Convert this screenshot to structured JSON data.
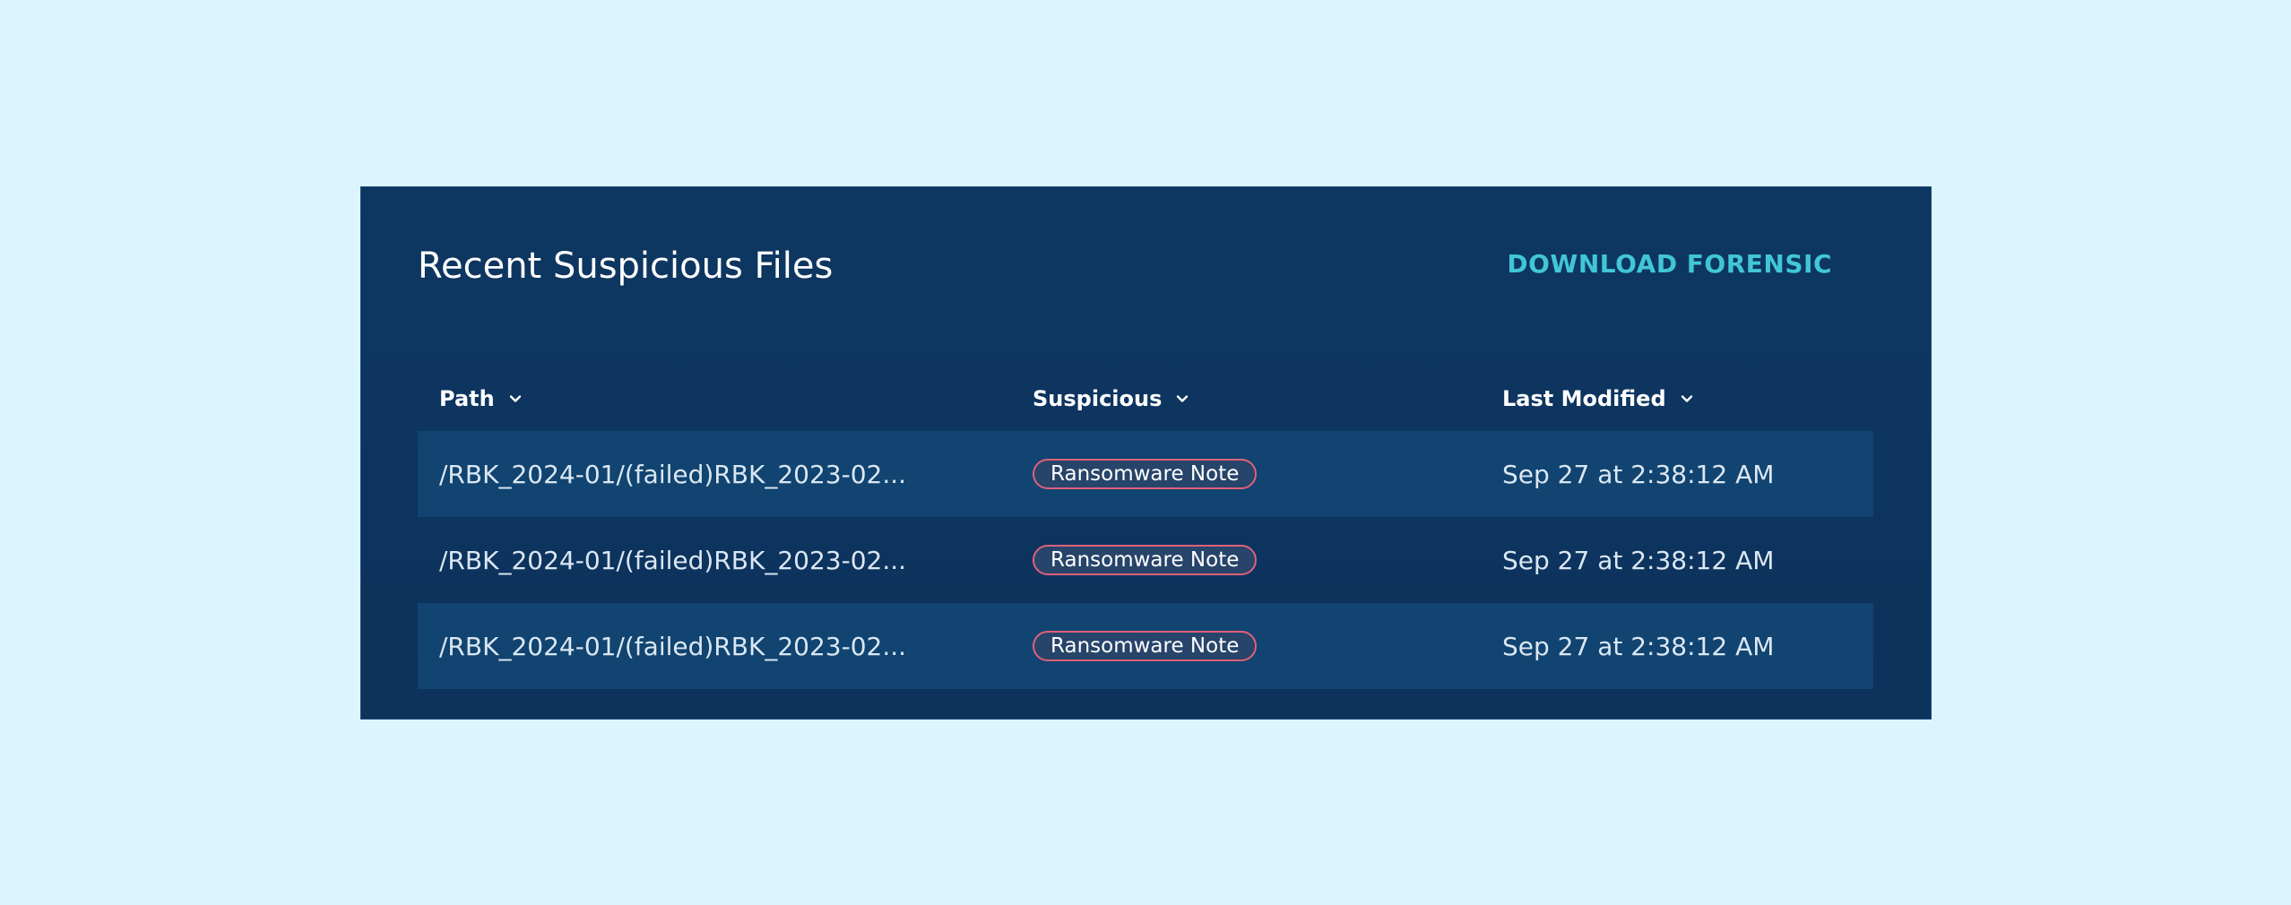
{
  "panel": {
    "title": "Recent Suspicious Files",
    "download_label": "DOWNLOAD FORENSIC"
  },
  "table": {
    "columns": [
      {
        "label": "Path",
        "icon": "chevron-down-icon"
      },
      {
        "label": "Suspicious",
        "icon": "chevron-down-icon"
      },
      {
        "label": "Last Modified",
        "icon": "chevron-down-icon"
      }
    ],
    "rows": [
      {
        "path": "/RBK_2024-01/(failed)RBK_2023-02...",
        "suspicious": "Ransomware Note",
        "modified": "Sep 27 at 2:38:12 AM"
      },
      {
        "path": "/RBK_2024-01/(failed)RBK_2023-02...",
        "suspicious": "Ransomware Note",
        "modified": "Sep 27 at 2:38:12 AM"
      },
      {
        "path": "/RBK_2024-01/(failed)RBK_2023-02...",
        "suspicious": "Ransomware Note",
        "modified": "Sep 27 at 2:38:12 AM"
      }
    ]
  },
  "colors": {
    "background": "#dcf4fe",
    "panel": "#0d3761",
    "row_alt": "#114470",
    "accent": "#41c6d6",
    "badge_border": "#e0607a"
  }
}
